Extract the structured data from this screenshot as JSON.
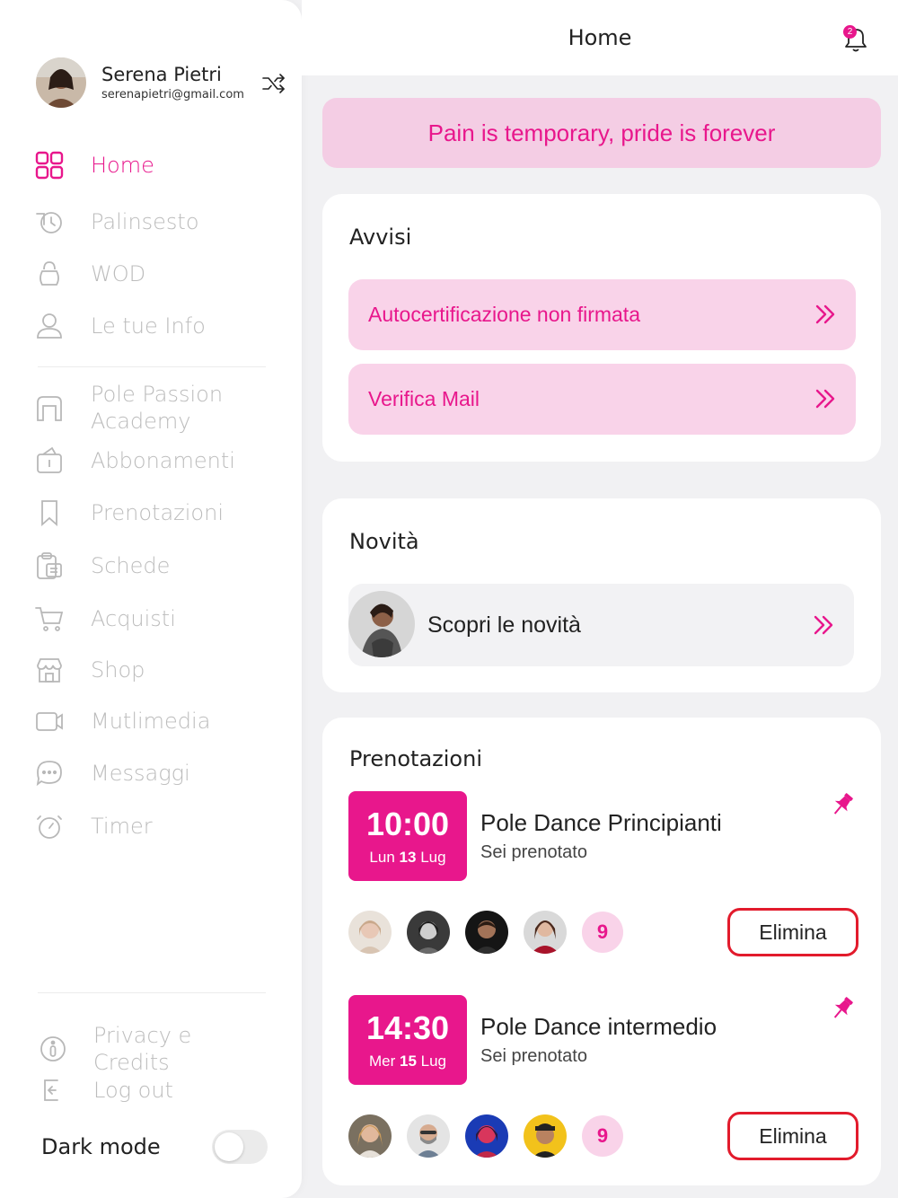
{
  "profile": {
    "name": "Serena Pietri",
    "email": "serenapietri@gmail.com"
  },
  "nav": {
    "main": [
      {
        "label": "Home",
        "icon": "grid-icon",
        "active": true
      },
      {
        "label": "Palinsesto",
        "icon": "history-icon"
      },
      {
        "label": "WOD",
        "icon": "kettlebell-icon"
      },
      {
        "label": "Le tue Info",
        "icon": "user-icon"
      }
    ],
    "secondary": [
      {
        "label": "Pole Passion\nAcademy",
        "icon": "gym-icon"
      },
      {
        "label": "Abbonamenti",
        "icon": "subscription-icon"
      },
      {
        "label": "Prenotazioni",
        "icon": "bookmark-icon"
      },
      {
        "label": "Schede",
        "icon": "clipboard-icon"
      },
      {
        "label": "Acquisti",
        "icon": "cart-icon"
      },
      {
        "label": "Shop",
        "icon": "store-icon"
      },
      {
        "label": "Mutlimedia",
        "icon": "video-icon"
      },
      {
        "label": "Messaggi",
        "icon": "chat-icon"
      },
      {
        "label": "Timer",
        "icon": "timer-icon"
      }
    ],
    "footer": [
      {
        "label": "Privacy e Credits",
        "icon": "info-icon"
      },
      {
        "label": "Log out",
        "icon": "logout-icon"
      }
    ]
  },
  "darkmode": {
    "label": "Dark mode",
    "enabled": false
  },
  "header": {
    "title": "Home",
    "notifications": "2"
  },
  "quote": "Pain is temporary, pride is forever",
  "avvisi": {
    "title": "Avvisi",
    "items": [
      "Autocertificazione non firmata",
      "Verifica Mail"
    ]
  },
  "novita": {
    "title": "Novità",
    "link": "Scopri le novità"
  },
  "prenotazioni": {
    "title": "Prenotazioni",
    "items": [
      {
        "time": "10:00",
        "day": "Lun",
        "date": "13",
        "month": "Lug",
        "title": "Pole Dance Principianti",
        "status": "Sei prenotato",
        "count": "9",
        "delete": "Elimina"
      },
      {
        "time": "14:30",
        "day": "Mer",
        "date": "15",
        "month": "Lug",
        "title": "Pole Dance intermedio",
        "status": "Sei prenotato",
        "count": "9",
        "delete": "Elimina"
      }
    ]
  },
  "colors": {
    "accent": "#e8178c",
    "accent_soft": "#f9d3e9",
    "danger": "#e21b2c"
  }
}
